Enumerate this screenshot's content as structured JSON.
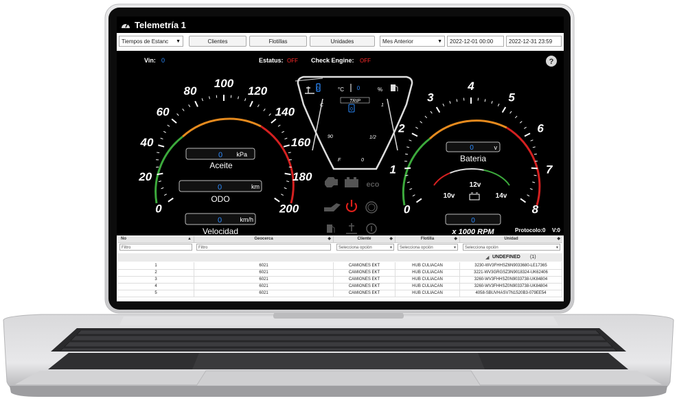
{
  "window": {
    "title": "Telemetría 1"
  },
  "toolbar": {
    "report_select": "Tiempos de Estanc",
    "clientes_button": "Clientes",
    "flotillas_button": "Flotillas",
    "unidades_button": "Unidades",
    "period_select": "Mes Anterior",
    "date_start": "2022-12-01 00:00",
    "date_end": "2022-12-31 23:59"
  },
  "dashboard": {
    "vin_label": "Vin:",
    "vin_value": "0",
    "status_label": "Estatus:",
    "status_value": "OFF",
    "check_engine_label": "Check Engine:",
    "check_engine_value": "OFF",
    "help": "?",
    "speed_ticks": [
      "0",
      "20",
      "40",
      "60",
      "80",
      "100",
      "120",
      "140",
      "160",
      "180",
      "200"
    ],
    "oil_value": "0",
    "oil_unit": "kPa",
    "oil_label": "Aceite",
    "odo_value": "0",
    "odo_unit": "km",
    "odo_label": "ODO",
    "speed_value": "0",
    "speed_unit": "km/h",
    "speed_label": "Velocidad",
    "temp_value": "0",
    "temp_unit": "°C",
    "fuel_value": "0",
    "fuel_unit": "%",
    "temp_c": "C",
    "temp_90": "90",
    "temp_f": "F",
    "trip_label": "TRIP",
    "trip_value": "0",
    "fuel_1": "1",
    "fuel_half": "1/2",
    "fuel_0": "0",
    "eco_label": "eco",
    "rpm_ticks": [
      "0",
      "1",
      "2",
      "3",
      "4",
      "5",
      "6",
      "7",
      "8"
    ],
    "battery_value": "0",
    "battery_unit": "v",
    "battery_label": "Bateria",
    "volt_low": "10v",
    "volt_mid": "12v",
    "volt_high": "14v",
    "rpm_value": "0",
    "rpm_label": "x 1000 RPM",
    "protocol": "Protocolo:0",
    "version": "V:0"
  },
  "grid": {
    "columns": [
      "No",
      "Geocerca",
      "Cliente",
      "Flotilla",
      "Unidad"
    ],
    "filter_placeholders": [
      "Filtro",
      "Filtro"
    ],
    "select_placeholder": "Selecciona opción",
    "group_label": "UNDEFINED",
    "group_count": "(1)",
    "rows": [
      [
        "1",
        "6021",
        "CAMIONES EKT",
        "HUB CULIACAN",
        "3230-WV3FHHSZ6N9033680-LE17365"
      ],
      [
        "2",
        "6021",
        "CAMIONES EKT",
        "HUB CULIACAN",
        "3221-WV3GRGSZ3N9018324-UK62406"
      ],
      [
        "3",
        "6021",
        "CAMIONES EKT",
        "HUB CULIACAN",
        "3260-WV3FHHSZ0N9033738-UK84804"
      ],
      [
        "4",
        "6021",
        "CAMIONES EKT",
        "HUB CULIACAN",
        "3260-WV3FHHSZ0N9033738-UK84804"
      ],
      [
        "5",
        "6021",
        "CAMIONES EKT",
        "HUB CULIACAN",
        "4058-SBUVHASV7N1520B3-079EE54"
      ]
    ]
  },
  "colors": {
    "status_off": "#ff2a2a",
    "value_blue": "#2d8cff",
    "power_red": "#e0201a"
  }
}
